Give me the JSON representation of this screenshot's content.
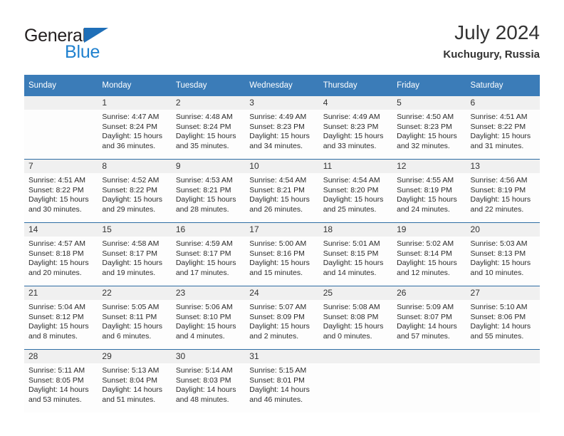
{
  "brand": {
    "name_part1": "General",
    "name_part2": "Blue",
    "triangle_color": "#1f6fb8",
    "blue_text_color": "#2081cf"
  },
  "header": {
    "title": "July 2024",
    "subtitle": "Kuchugury, Russia"
  },
  "theme": {
    "header_blue": "#3b7cb8",
    "row_divider_blue": "#2e6da4",
    "daynum_band_gray": "#f0f0f0"
  },
  "weekday_headers": [
    "Sunday",
    "Monday",
    "Tuesday",
    "Wednesday",
    "Thursday",
    "Friday",
    "Saturday"
  ],
  "weeks": [
    [
      {
        "day": "",
        "lines": []
      },
      {
        "day": "1",
        "lines": [
          "Sunrise: 4:47 AM",
          "Sunset: 8:24 PM",
          "Daylight: 15 hours",
          "and 36 minutes."
        ]
      },
      {
        "day": "2",
        "lines": [
          "Sunrise: 4:48 AM",
          "Sunset: 8:24 PM",
          "Daylight: 15 hours",
          "and 35 minutes."
        ]
      },
      {
        "day": "3",
        "lines": [
          "Sunrise: 4:49 AM",
          "Sunset: 8:23 PM",
          "Daylight: 15 hours",
          "and 34 minutes."
        ]
      },
      {
        "day": "4",
        "lines": [
          "Sunrise: 4:49 AM",
          "Sunset: 8:23 PM",
          "Daylight: 15 hours",
          "and 33 minutes."
        ]
      },
      {
        "day": "5",
        "lines": [
          "Sunrise: 4:50 AM",
          "Sunset: 8:23 PM",
          "Daylight: 15 hours",
          "and 32 minutes."
        ]
      },
      {
        "day": "6",
        "lines": [
          "Sunrise: 4:51 AM",
          "Sunset: 8:22 PM",
          "Daylight: 15 hours",
          "and 31 minutes."
        ]
      }
    ],
    [
      {
        "day": "7",
        "lines": [
          "Sunrise: 4:51 AM",
          "Sunset: 8:22 PM",
          "Daylight: 15 hours",
          "and 30 minutes."
        ]
      },
      {
        "day": "8",
        "lines": [
          "Sunrise: 4:52 AM",
          "Sunset: 8:22 PM",
          "Daylight: 15 hours",
          "and 29 minutes."
        ]
      },
      {
        "day": "9",
        "lines": [
          "Sunrise: 4:53 AM",
          "Sunset: 8:21 PM",
          "Daylight: 15 hours",
          "and 28 minutes."
        ]
      },
      {
        "day": "10",
        "lines": [
          "Sunrise: 4:54 AM",
          "Sunset: 8:21 PM",
          "Daylight: 15 hours",
          "and 26 minutes."
        ]
      },
      {
        "day": "11",
        "lines": [
          "Sunrise: 4:54 AM",
          "Sunset: 8:20 PM",
          "Daylight: 15 hours",
          "and 25 minutes."
        ]
      },
      {
        "day": "12",
        "lines": [
          "Sunrise: 4:55 AM",
          "Sunset: 8:19 PM",
          "Daylight: 15 hours",
          "and 24 minutes."
        ]
      },
      {
        "day": "13",
        "lines": [
          "Sunrise: 4:56 AM",
          "Sunset: 8:19 PM",
          "Daylight: 15 hours",
          "and 22 minutes."
        ]
      }
    ],
    [
      {
        "day": "14",
        "lines": [
          "Sunrise: 4:57 AM",
          "Sunset: 8:18 PM",
          "Daylight: 15 hours",
          "and 20 minutes."
        ]
      },
      {
        "day": "15",
        "lines": [
          "Sunrise: 4:58 AM",
          "Sunset: 8:17 PM",
          "Daylight: 15 hours",
          "and 19 minutes."
        ]
      },
      {
        "day": "16",
        "lines": [
          "Sunrise: 4:59 AM",
          "Sunset: 8:17 PM",
          "Daylight: 15 hours",
          "and 17 minutes."
        ]
      },
      {
        "day": "17",
        "lines": [
          "Sunrise: 5:00 AM",
          "Sunset: 8:16 PM",
          "Daylight: 15 hours",
          "and 15 minutes."
        ]
      },
      {
        "day": "18",
        "lines": [
          "Sunrise: 5:01 AM",
          "Sunset: 8:15 PM",
          "Daylight: 15 hours",
          "and 14 minutes."
        ]
      },
      {
        "day": "19",
        "lines": [
          "Sunrise: 5:02 AM",
          "Sunset: 8:14 PM",
          "Daylight: 15 hours",
          "and 12 minutes."
        ]
      },
      {
        "day": "20",
        "lines": [
          "Sunrise: 5:03 AM",
          "Sunset: 8:13 PM",
          "Daylight: 15 hours",
          "and 10 minutes."
        ]
      }
    ],
    [
      {
        "day": "21",
        "lines": [
          "Sunrise: 5:04 AM",
          "Sunset: 8:12 PM",
          "Daylight: 15 hours",
          "and 8 minutes."
        ]
      },
      {
        "day": "22",
        "lines": [
          "Sunrise: 5:05 AM",
          "Sunset: 8:11 PM",
          "Daylight: 15 hours",
          "and 6 minutes."
        ]
      },
      {
        "day": "23",
        "lines": [
          "Sunrise: 5:06 AM",
          "Sunset: 8:10 PM",
          "Daylight: 15 hours",
          "and 4 minutes."
        ]
      },
      {
        "day": "24",
        "lines": [
          "Sunrise: 5:07 AM",
          "Sunset: 8:09 PM",
          "Daylight: 15 hours",
          "and 2 minutes."
        ]
      },
      {
        "day": "25",
        "lines": [
          "Sunrise: 5:08 AM",
          "Sunset: 8:08 PM",
          "Daylight: 15 hours",
          "and 0 minutes."
        ]
      },
      {
        "day": "26",
        "lines": [
          "Sunrise: 5:09 AM",
          "Sunset: 8:07 PM",
          "Daylight: 14 hours",
          "and 57 minutes."
        ]
      },
      {
        "day": "27",
        "lines": [
          "Sunrise: 5:10 AM",
          "Sunset: 8:06 PM",
          "Daylight: 14 hours",
          "and 55 minutes."
        ]
      }
    ],
    [
      {
        "day": "28",
        "lines": [
          "Sunrise: 5:11 AM",
          "Sunset: 8:05 PM",
          "Daylight: 14 hours",
          "and 53 minutes."
        ]
      },
      {
        "day": "29",
        "lines": [
          "Sunrise: 5:13 AM",
          "Sunset: 8:04 PM",
          "Daylight: 14 hours",
          "and 51 minutes."
        ]
      },
      {
        "day": "30",
        "lines": [
          "Sunrise: 5:14 AM",
          "Sunset: 8:03 PM",
          "Daylight: 14 hours",
          "and 48 minutes."
        ]
      },
      {
        "day": "31",
        "lines": [
          "Sunrise: 5:15 AM",
          "Sunset: 8:01 PM",
          "Daylight: 14 hours",
          "and 46 minutes."
        ]
      },
      {
        "day": "",
        "lines": []
      },
      {
        "day": "",
        "lines": []
      },
      {
        "day": "",
        "lines": []
      }
    ]
  ]
}
